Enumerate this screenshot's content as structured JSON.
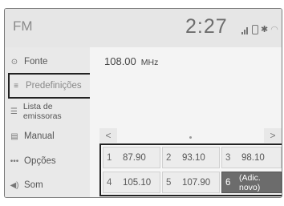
{
  "header": {
    "title": "FM",
    "clock": "2:27"
  },
  "status_icons": [
    "signal-icon",
    "phone-icon",
    "bluetooth-icon",
    "wifi-icon"
  ],
  "sidebar": {
    "items": [
      {
        "label": "Fonte",
        "icon": "source-icon"
      },
      {
        "label": "Predefinições",
        "icon": "presets-icon",
        "active": true
      },
      {
        "label": "Lista de emissoras",
        "icon": "station-list-icon"
      },
      {
        "label": "Manual",
        "icon": "manual-icon"
      },
      {
        "label": "Opções",
        "icon": "options-icon"
      },
      {
        "label": "Som",
        "icon": "sound-icon"
      }
    ]
  },
  "main": {
    "frequency": "108.00",
    "frequency_unit": "MHz",
    "nav_prev": "<",
    "nav_next": ">",
    "presets": [
      {
        "num": "1",
        "value": "87.90"
      },
      {
        "num": "2",
        "value": "93.10"
      },
      {
        "num": "3",
        "value": "98.10"
      },
      {
        "num": "4",
        "value": "105.10"
      },
      {
        "num": "5",
        "value": "107.90"
      },
      {
        "num": "6",
        "value": "(Adic. novo)"
      }
    ]
  },
  "glyphs": {
    "bluetooth": "✱",
    "wifi": "◠",
    "options": "•••",
    "sound": "◀)",
    "source": "⊙",
    "presets": "≡",
    "list": "☰",
    "manual": "▤"
  }
}
